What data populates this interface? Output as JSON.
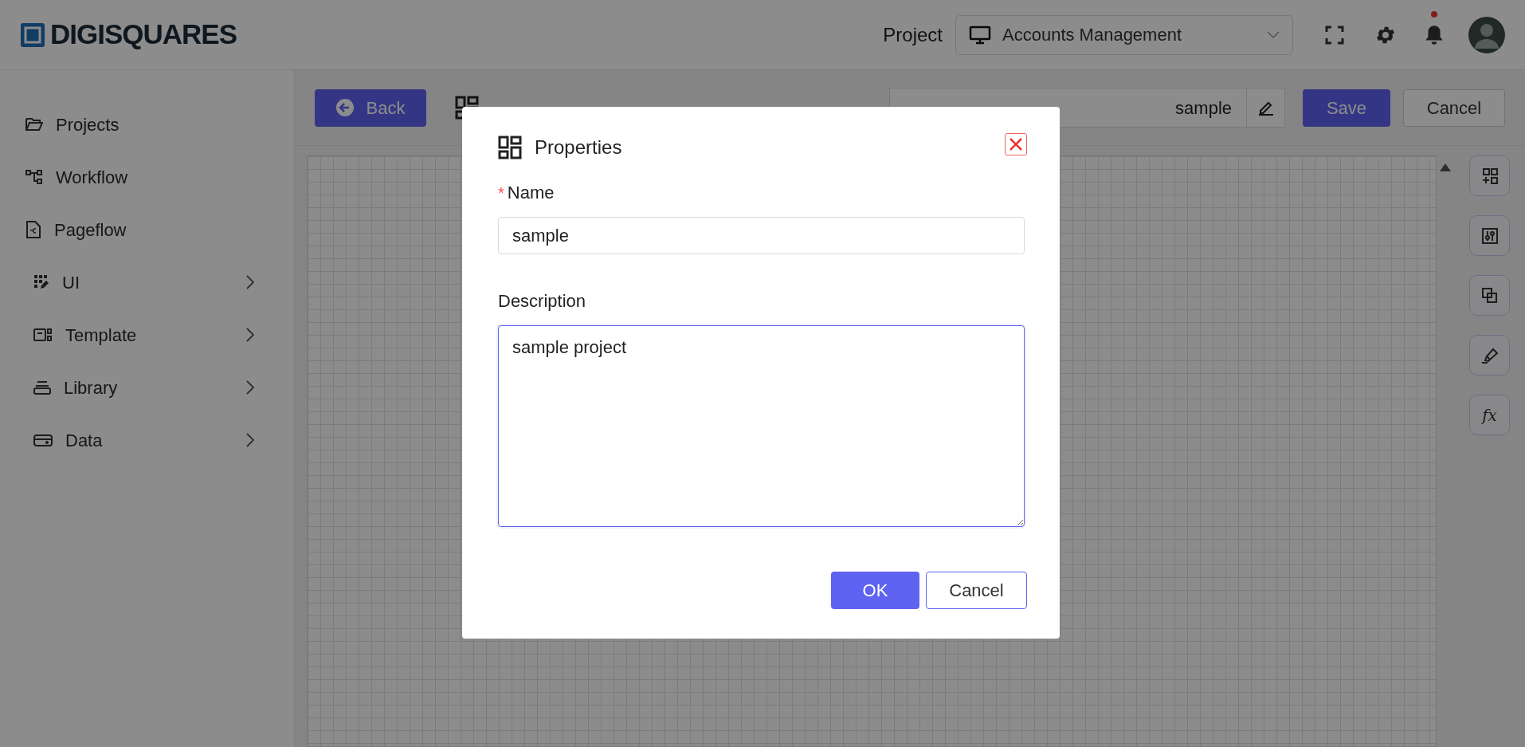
{
  "header": {
    "logo": "DIGISQUARES",
    "project_label": "Project",
    "project_select": "Accounts Management",
    "notifications": true
  },
  "sidebar": {
    "items": [
      {
        "label": "Projects",
        "expandable": false
      },
      {
        "label": "Workflow",
        "expandable": false
      },
      {
        "label": "Pageflow",
        "expandable": false
      },
      {
        "label": "UI",
        "expandable": true
      },
      {
        "label": "Template",
        "expandable": true
      },
      {
        "label": "Library",
        "expandable": true
      },
      {
        "label": "Data",
        "expandable": true
      }
    ]
  },
  "toolbar": {
    "back": "Back",
    "name_value": "sample",
    "save": "Save",
    "cancel": "Cancel"
  },
  "side_tools": {
    "function_label": "fx"
  },
  "dialog": {
    "title": "Properties",
    "fields": [
      {
        "kind": "input",
        "label": "Name",
        "required_mark": "*",
        "value": "sample",
        "focused": false
      },
      {
        "kind": "textarea",
        "label": "Description",
        "value": "sample project",
        "focused": true
      }
    ],
    "buttons": [
      {
        "label": "OK",
        "primary": true
      },
      {
        "label": "Cancel",
        "primary": false
      }
    ]
  }
}
